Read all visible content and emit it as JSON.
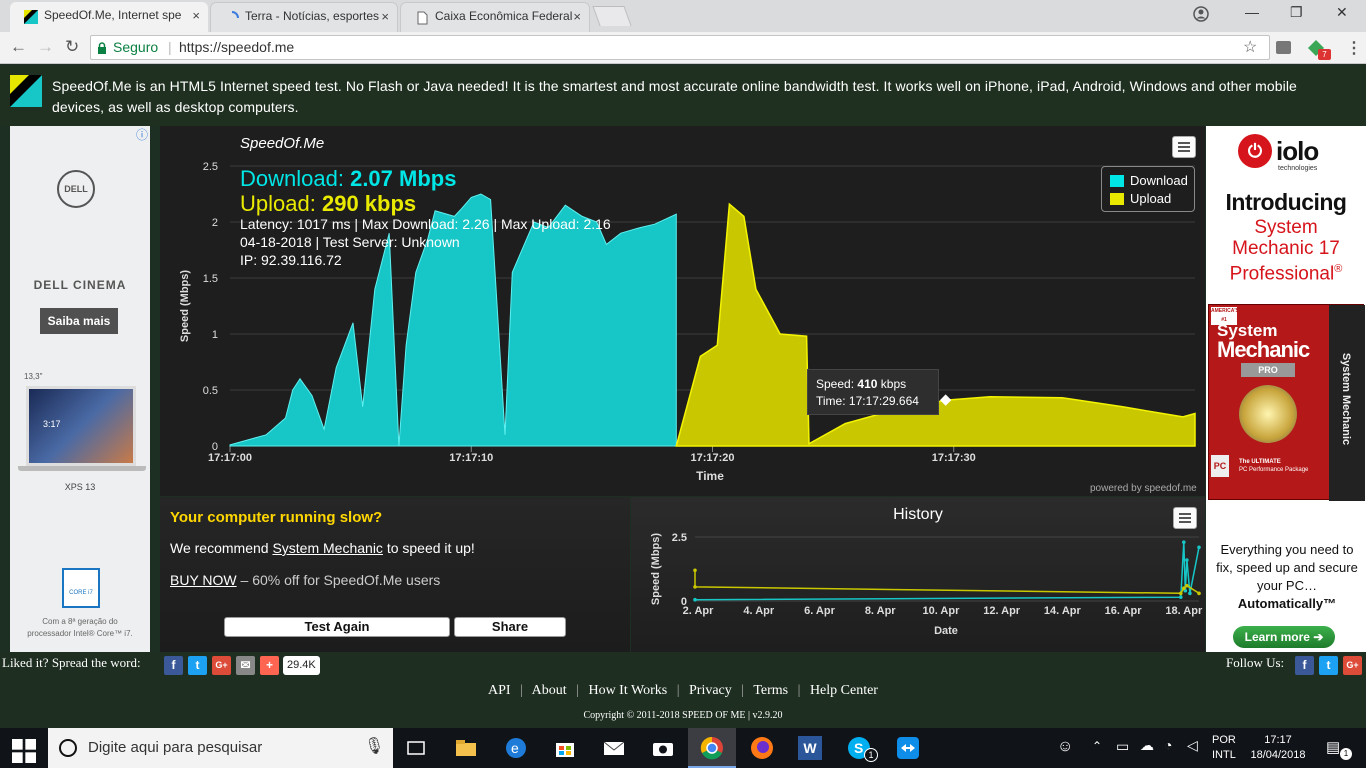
{
  "tabs": [
    {
      "title": "SpeedOf.Me, Internet spe",
      "close": "×"
    },
    {
      "title": "Terra - Notícias, esportes",
      "close": "×"
    },
    {
      "title": "Caixa Econômica Federal",
      "close": "×"
    }
  ],
  "window_controls": {
    "minimize": "—",
    "maximize": "❐",
    "close": "✕"
  },
  "address_bar": {
    "secure_label": "Seguro",
    "separator": "|",
    "url": "https://speedof.me",
    "ext_badge": "7"
  },
  "site": {
    "tagline": "SpeedOf.Me is an HTML5 Internet speed test. No Flash or Java needed! It is the smartest and most accurate online bandwidth test. It works well on iPhone, iPad, Android, Windows and other mobile devices, as well as desktop computers."
  },
  "left_ad": {
    "info_icon": "ⓘ",
    "brand": "DELL",
    "product": "DELL CINEMA",
    "cta": "Saiba mais",
    "size": "13,3\"",
    "laptop_time": "3:17",
    "model": "XPS 13",
    "chip": "CORE i7",
    "footnote": "Com a 8ª geração do processador Intel® Core™ i7."
  },
  "chart": {
    "title": "SpeedOf.Me",
    "download_label": "Download:",
    "download_value": "2.07 Mbps",
    "upload_label": "Upload:",
    "upload_value": "290 kbps",
    "stats_line1": "Latency: 1017 ms | Max Download: 2.26 | Max Upload: 2.16",
    "stats_line2": "04-18-2018 | Test Server: Unknown",
    "stats_line3": "IP: 92.39.116.72",
    "y_axis_label": "Speed (Mbps)",
    "x_axis_label": "Time",
    "y_ticks": [
      "0",
      "0.5",
      "1",
      "1.5",
      "2",
      "2.5"
    ],
    "x_ticks": [
      "17:17:00",
      "17:17:10",
      "17:17:20",
      "17:17:30"
    ],
    "legend_download": "Download",
    "legend_upload": "Upload",
    "tooltip_speed_label": "Speed:",
    "tooltip_speed_value": "410",
    "tooltip_speed_unit": "kbps",
    "tooltip_time": "Time: 17:17:29.664",
    "credit": "powered by speedof.me",
    "colors": {
      "download": "#17c6c6",
      "upload": "#c9c800",
      "legend_download": "#00e5e5",
      "legend_upload": "#e9e900"
    }
  },
  "chart_data": [
    {
      "type": "area",
      "title": "SpeedOf.Me",
      "xlabel": "Time",
      "ylabel": "Speed (Mbps)",
      "ylim": [
        0,
        2.5
      ],
      "xlim": [
        "17:17:00",
        "17:17:40"
      ],
      "grid": true,
      "legend": "top-right",
      "series": [
        {
          "name": "Download",
          "color": "#17c6c6",
          "x": [
            0,
            1.5,
            2.3,
            2.6,
            2.9,
            3.4,
            3.9,
            4.4,
            5.1,
            5.5,
            6.0,
            6.6,
            7.0,
            7.3,
            7.7,
            8.2,
            8.5,
            9.3,
            9.6,
            10.0,
            10.4,
            10.8,
            11.4,
            11.7,
            12.3,
            12.6,
            13.2,
            13.9,
            14.6,
            15.2,
            15.6,
            16.2,
            17.0,
            17.6,
            18.5,
            18.5,
            0
          ],
          "y": [
            0.01,
            0.1,
            0.25,
            0.5,
            0.6,
            0.45,
            0.15,
            0.7,
            1.1,
            0.35,
            1.4,
            1.9,
            0.0,
            0.9,
            1.55,
            1.85,
            2.1,
            2.05,
            2.12,
            2.22,
            2.25,
            2.2,
            0.1,
            1.55,
            1.85,
            2.0,
            1.95,
            2.15,
            2.05,
            2.0,
            1.8,
            1.9,
            1.95,
            1.98,
            2.07,
            0,
            0
          ]
        },
        {
          "name": "Upload",
          "color": "#c9c800",
          "x": [
            18.5,
            19.5,
            20.2,
            20.7,
            21.3,
            21.8,
            22.8,
            23.9,
            24.0,
            25.5,
            27.5,
            29.7,
            31.5,
            34.5,
            37.0,
            39.5,
            40.0
          ],
          "y": [
            0.0,
            0.8,
            0.9,
            2.16,
            2.05,
            1.4,
            1.0,
            0.98,
            0.02,
            0.2,
            0.32,
            0.41,
            0.44,
            0.43,
            0.35,
            0.26,
            0.29
          ]
        }
      ]
    },
    {
      "type": "line",
      "title": "History",
      "xlabel": "Date",
      "ylabel": "Speed (Mbps)",
      "ylim": [
        0,
        2.5
      ],
      "x_ticks": [
        "2. Apr",
        "4. Apr",
        "6. Apr",
        "8. Apr",
        "10. Apr",
        "12. Apr",
        "14. Apr",
        "16. Apr",
        "18. Apr"
      ],
      "y_ticks": [
        "0",
        "2.5"
      ],
      "series": [
        {
          "name": "Download",
          "color": "#17c6c6",
          "x": [
            1.9,
            17.9,
            18.0,
            18.05,
            18.1,
            18.2,
            18.5
          ],
          "y": [
            0.05,
            0.15,
            2.3,
            0.4,
            1.6,
            0.3,
            2.1
          ]
        },
        {
          "name": "Upload",
          "color": "#c9c800",
          "x": [
            1.9,
            1.9,
            17.9,
            18.0,
            18.1,
            18.5
          ],
          "y": [
            1.2,
            0.55,
            0.3,
            0.5,
            0.6,
            0.3
          ]
        }
      ]
    }
  ],
  "promo": {
    "heading": "Your computer running slow?",
    "line_pre": "We recommend",
    "line_link": "System Mechanic",
    "line_post": "to speed it up!",
    "buy_link": "BUY NOW",
    "buy_post": "– 60% off for SpeedOf.Me users",
    "test_again": "Test Again",
    "share": "Share"
  },
  "history": {
    "title": "History"
  },
  "right_ad": {
    "brand": "iolo",
    "brand_sub": "technologies",
    "intro": "Introducing",
    "product_line1": "System",
    "product_line2": "Mechanic 17",
    "product_line3": "Professional",
    "reg": "®",
    "box_title1": "System",
    "box_title2": "Mechanic",
    "box_pro": "PRO",
    "box_side": "System Mechanic",
    "box_ultimate": "The ULTIMATE",
    "box_package": "PC Performance Package",
    "box_top": "AMERICA'S #1",
    "box_pc": "PC",
    "desc": "Everything you need to fix, speed up and secure your PC…",
    "desc_bold": "Automatically™",
    "cta": "Learn more"
  },
  "footer": {
    "spread": "Liked it? Spread the word:",
    "share_count": "29.4K",
    "follow": "Follow Us:",
    "links": [
      "API",
      "About",
      "How It Works",
      "Privacy",
      "Terms",
      "Help Center"
    ],
    "copyright": "Copyright © 2011-2018 SPEED OF ME | v2.9.20",
    "social": [
      "f",
      "t",
      "G+",
      "✉",
      "+"
    ]
  },
  "taskbar": {
    "search_placeholder": "Digite aqui para pesquisar",
    "lang1": "POR",
    "lang2": "INTL",
    "time": "17:17",
    "date": "18/04/2018",
    "notif_count": "1",
    "skype_badge": "1",
    "word_letter": "W"
  }
}
